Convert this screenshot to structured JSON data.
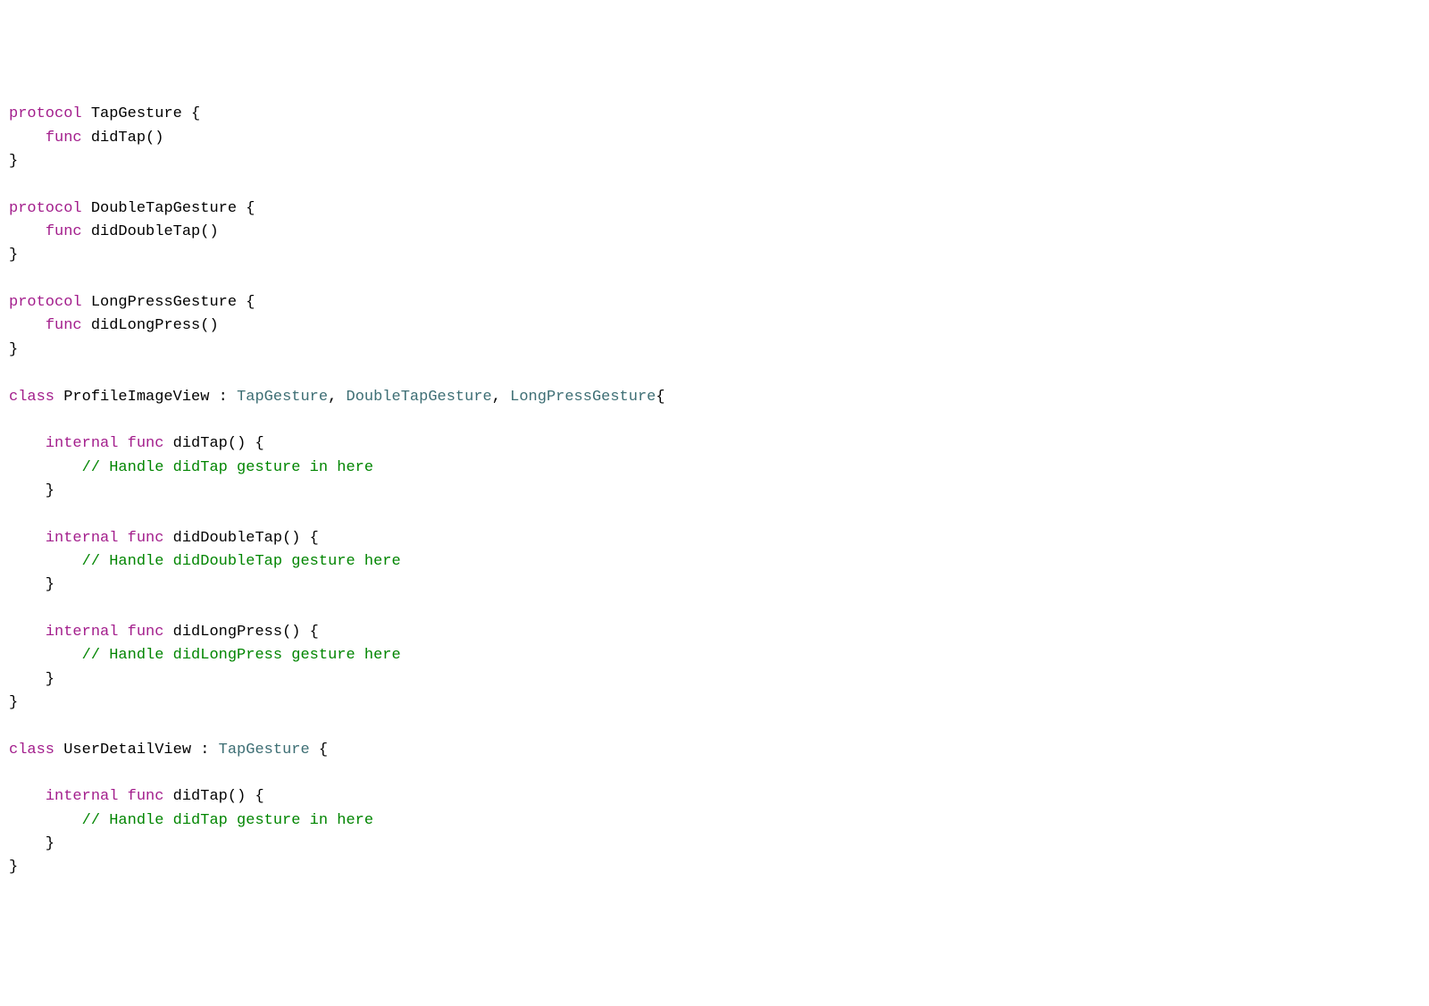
{
  "code": {
    "lines": [
      [
        {
          "cls": "tok-keyword",
          "t": "protocol"
        },
        {
          "cls": "tok-default",
          "t": " TapGesture {"
        }
      ],
      [
        {
          "cls": "tok-default",
          "t": "    "
        },
        {
          "cls": "tok-keyword",
          "t": "func"
        },
        {
          "cls": "tok-default",
          "t": " didTap()"
        }
      ],
      [
        {
          "cls": "tok-default",
          "t": "}"
        }
      ],
      [
        {
          "cls": "tok-default",
          "t": ""
        }
      ],
      [
        {
          "cls": "tok-keyword",
          "t": "protocol"
        },
        {
          "cls": "tok-default",
          "t": " DoubleTapGesture {"
        }
      ],
      [
        {
          "cls": "tok-default",
          "t": "    "
        },
        {
          "cls": "tok-keyword",
          "t": "func"
        },
        {
          "cls": "tok-default",
          "t": " didDoubleTap()"
        }
      ],
      [
        {
          "cls": "tok-default",
          "t": "}"
        }
      ],
      [
        {
          "cls": "tok-default",
          "t": ""
        }
      ],
      [
        {
          "cls": "tok-keyword",
          "t": "protocol"
        },
        {
          "cls": "tok-default",
          "t": " LongPressGesture {"
        }
      ],
      [
        {
          "cls": "tok-default",
          "t": "    "
        },
        {
          "cls": "tok-keyword",
          "t": "func"
        },
        {
          "cls": "tok-default",
          "t": " didLongPress()"
        }
      ],
      [
        {
          "cls": "tok-default",
          "t": "}"
        }
      ],
      [
        {
          "cls": "tok-default",
          "t": ""
        }
      ],
      [
        {
          "cls": "tok-keyword",
          "t": "class"
        },
        {
          "cls": "tok-default",
          "t": " ProfileImageView : "
        },
        {
          "cls": "tok-type",
          "t": "TapGesture"
        },
        {
          "cls": "tok-default",
          "t": ", "
        },
        {
          "cls": "tok-type",
          "t": "DoubleTapGesture"
        },
        {
          "cls": "tok-default",
          "t": ", "
        },
        {
          "cls": "tok-type",
          "t": "LongPressGesture"
        },
        {
          "cls": "tok-default",
          "t": "{"
        }
      ],
      [
        {
          "cls": "tok-default",
          "t": ""
        }
      ],
      [
        {
          "cls": "tok-default",
          "t": "    "
        },
        {
          "cls": "tok-keyword",
          "t": "internal"
        },
        {
          "cls": "tok-default",
          "t": " "
        },
        {
          "cls": "tok-keyword",
          "t": "func"
        },
        {
          "cls": "tok-default",
          "t": " didTap() {"
        }
      ],
      [
        {
          "cls": "tok-default",
          "t": "        "
        },
        {
          "cls": "tok-comment",
          "t": "// Handle didTap gesture in here"
        }
      ],
      [
        {
          "cls": "tok-default",
          "t": "    }"
        }
      ],
      [
        {
          "cls": "tok-default",
          "t": ""
        }
      ],
      [
        {
          "cls": "tok-default",
          "t": "    "
        },
        {
          "cls": "tok-keyword",
          "t": "internal"
        },
        {
          "cls": "tok-default",
          "t": " "
        },
        {
          "cls": "tok-keyword",
          "t": "func"
        },
        {
          "cls": "tok-default",
          "t": " didDoubleTap() {"
        }
      ],
      [
        {
          "cls": "tok-default",
          "t": "        "
        },
        {
          "cls": "tok-comment",
          "t": "// Handle didDoubleTap gesture here"
        }
      ],
      [
        {
          "cls": "tok-default",
          "t": "    }"
        }
      ],
      [
        {
          "cls": "tok-default",
          "t": ""
        }
      ],
      [
        {
          "cls": "tok-default",
          "t": "    "
        },
        {
          "cls": "tok-keyword",
          "t": "internal"
        },
        {
          "cls": "tok-default",
          "t": " "
        },
        {
          "cls": "tok-keyword",
          "t": "func"
        },
        {
          "cls": "tok-default",
          "t": " didLongPress() {"
        }
      ],
      [
        {
          "cls": "tok-default",
          "t": "        "
        },
        {
          "cls": "tok-comment",
          "t": "// Handle didLongPress gesture here"
        }
      ],
      [
        {
          "cls": "tok-default",
          "t": "    }"
        }
      ],
      [
        {
          "cls": "tok-default",
          "t": "}"
        }
      ],
      [
        {
          "cls": "tok-default",
          "t": ""
        }
      ],
      [
        {
          "cls": "tok-keyword",
          "t": "class"
        },
        {
          "cls": "tok-default",
          "t": " UserDetailView : "
        },
        {
          "cls": "tok-type",
          "t": "TapGesture"
        },
        {
          "cls": "tok-default",
          "t": " {"
        }
      ],
      [
        {
          "cls": "tok-default",
          "t": ""
        }
      ],
      [
        {
          "cls": "tok-default",
          "t": "    "
        },
        {
          "cls": "tok-keyword",
          "t": "internal"
        },
        {
          "cls": "tok-default",
          "t": " "
        },
        {
          "cls": "tok-keyword",
          "t": "func"
        },
        {
          "cls": "tok-default",
          "t": " didTap() {"
        }
      ],
      [
        {
          "cls": "tok-default",
          "t": "        "
        },
        {
          "cls": "tok-comment",
          "t": "// Handle didTap gesture in here"
        }
      ],
      [
        {
          "cls": "tok-default",
          "t": "    }"
        }
      ],
      [
        {
          "cls": "tok-default",
          "t": "}"
        }
      ]
    ]
  }
}
